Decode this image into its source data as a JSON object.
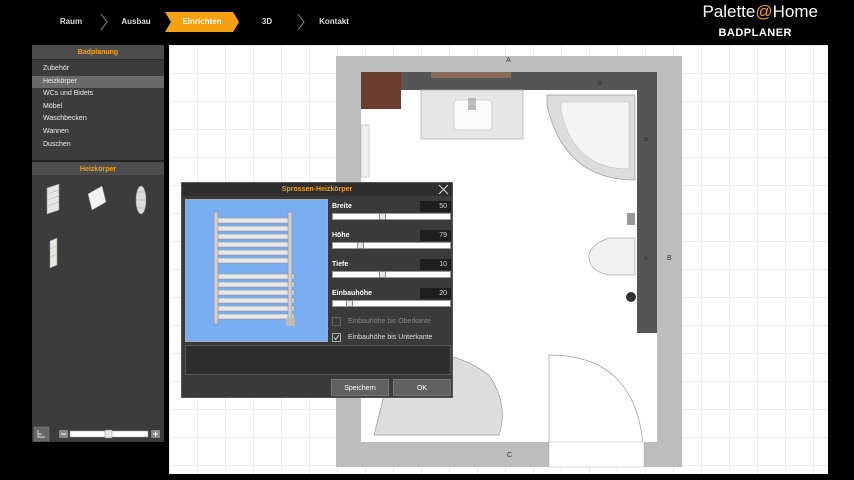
{
  "nav": {
    "steps": [
      {
        "label": "Raum"
      },
      {
        "label": "Ausbau"
      },
      {
        "label": "Einrichten",
        "active": true
      },
      {
        "label": "3D"
      },
      {
        "label": "Kontakt"
      }
    ]
  },
  "brand": {
    "prefix": "Palette",
    "at": "@",
    "suffix": "Home",
    "subtitle": "BADPLANER"
  },
  "sidebar": {
    "heading": "Badplanung",
    "items": [
      {
        "label": "Zubehör"
      },
      {
        "label": "Heizkörper",
        "selected": true
      },
      {
        "label": "WCs und Bidets"
      },
      {
        "label": "Möbel"
      },
      {
        "label": "Waschbecken"
      },
      {
        "label": "Wannen"
      },
      {
        "label": "Duschen"
      }
    ],
    "section_heading": "Heizkörper"
  },
  "room": {
    "walls": [
      "A",
      "a",
      "a",
      "a",
      "B",
      "C"
    ]
  },
  "dialog": {
    "title": "Sprossen-Heizkörper",
    "fields": [
      {
        "label": "Breite",
        "value": "50",
        "fraction": 0.42
      },
      {
        "label": "Höhe",
        "value": "79",
        "fraction": 0.22
      },
      {
        "label": "Tiefe",
        "value": "10",
        "fraction": 0.42
      },
      {
        "label": "Einbauhöhe",
        "value": "20",
        "fraction": 0.12
      }
    ],
    "checkboxes": [
      {
        "label": "Einbauhöhe bis Oberkante",
        "checked": false,
        "disabled": true
      },
      {
        "label": "Einbauhöhe bis Unterkante",
        "checked": true,
        "disabled": false
      }
    ],
    "save_label": "Speichern",
    "ok_label": "OK"
  },
  "colors": {
    "accent": "#f5a010",
    "panel": "#3c3c3c",
    "preview_bg": "#7aaef2",
    "wall": "#bdbdbd"
  }
}
